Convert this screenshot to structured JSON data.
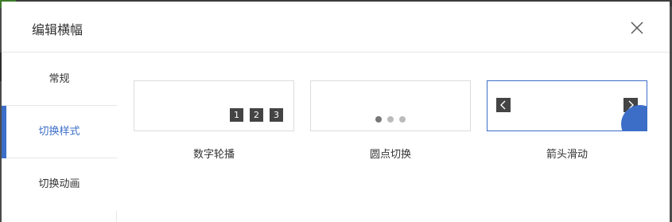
{
  "dialog": {
    "title": "编辑横幅",
    "close_icon": "close-icon"
  },
  "nav": {
    "items": [
      {
        "label": "常规",
        "active": false
      },
      {
        "label": "切换样式",
        "active": true
      },
      {
        "label": "切换动画",
        "active": false
      }
    ]
  },
  "options": [
    {
      "label": "数字轮播",
      "numbers": [
        "1",
        "2",
        "3"
      ],
      "selected": false
    },
    {
      "label": "圆点切换",
      "selected": false
    },
    {
      "label": "箭头滑动",
      "selected": true
    }
  ],
  "colors": {
    "accent": "#3c6ec8",
    "dark_control": "#444444",
    "border": "#dcdcdc"
  }
}
